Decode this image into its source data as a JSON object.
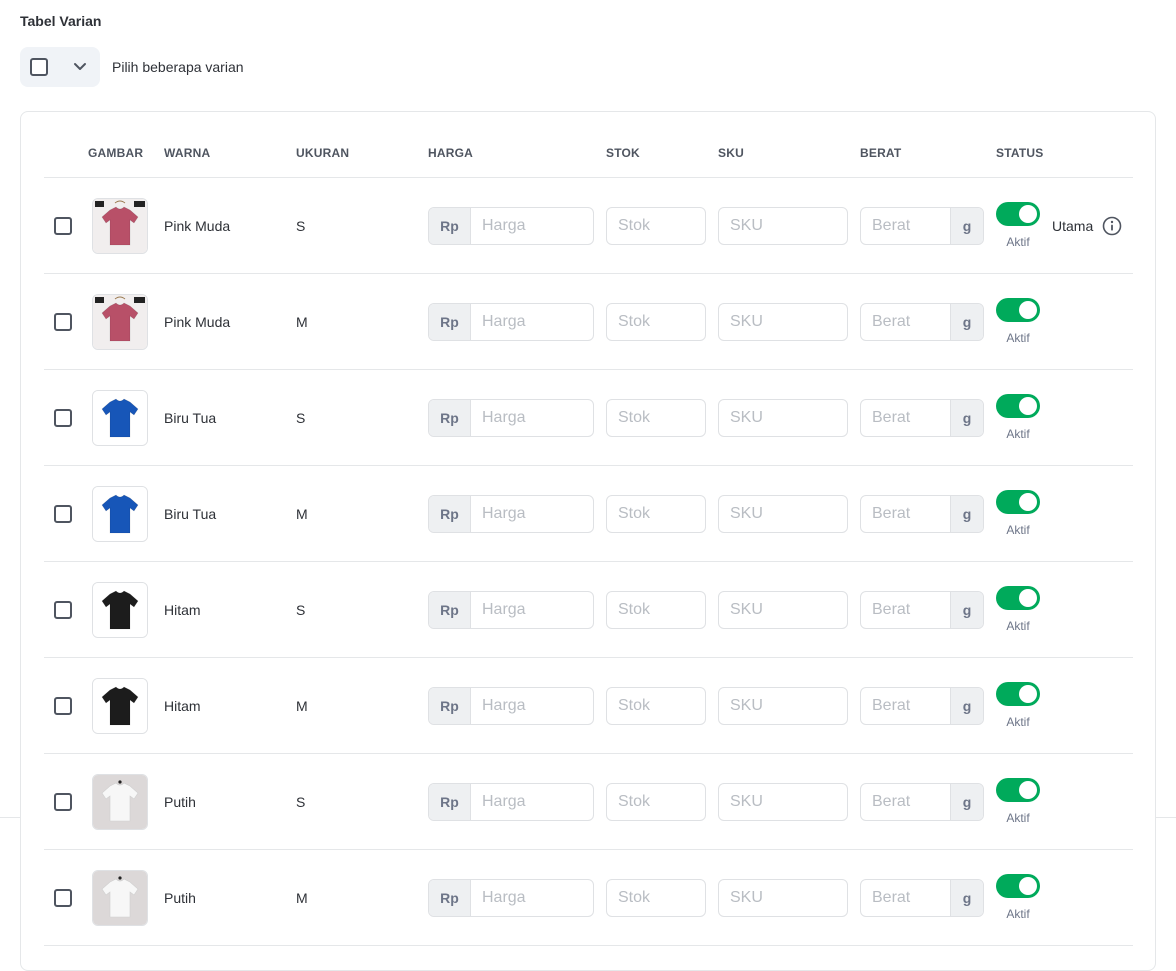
{
  "section_title": "Tabel Varian",
  "bulk_select": {
    "label": "Pilih beberapa varian"
  },
  "columns": [
    "GAMBAR",
    "WARNA",
    "UKURAN",
    "HARGA",
    "STOK",
    "SKU",
    "BERAT",
    "STATUS"
  ],
  "placeholders": {
    "harga": "Harga",
    "stok": "Stok",
    "sku": "SKU",
    "berat": "Berat"
  },
  "prefix": "Rp",
  "suffix": "g",
  "main_label": "Utama",
  "rows": [
    {
      "color": "Pink Muda",
      "size": "S",
      "status": "Aktif",
      "image": "pink-tshirt",
      "shirt_color": "#b85068"
    },
    {
      "color": "Pink Muda",
      "size": "M",
      "status": "Aktif",
      "image": "pink-tshirt",
      "shirt_color": "#b85068"
    },
    {
      "color": "Biru Tua",
      "size": "S",
      "status": "Aktif",
      "image": "blue-tshirt",
      "shirt_color": "#1756b8"
    },
    {
      "color": "Biru Tua",
      "size": "M",
      "status": "Aktif",
      "image": "blue-tshirt",
      "shirt_color": "#1756b8"
    },
    {
      "color": "Hitam",
      "size": "S",
      "status": "Aktif",
      "image": "black-tshirt",
      "shirt_color": "#1c1c1c"
    },
    {
      "color": "Hitam",
      "size": "M",
      "status": "Aktif",
      "image": "black-tshirt",
      "shirt_color": "#1c1c1c"
    },
    {
      "color": "Putih",
      "size": "S",
      "status": "Aktif",
      "image": "white-tshirt",
      "shirt_color": "#f7f7f7"
    },
    {
      "color": "Putih",
      "size": "M",
      "status": "Aktif",
      "image": "white-tshirt",
      "shirt_color": "#f7f7f7"
    }
  ],
  "colors": {
    "toggle_on": "#00aa5b",
    "border": "#dfe1e4",
    "text": "#2e3137"
  }
}
